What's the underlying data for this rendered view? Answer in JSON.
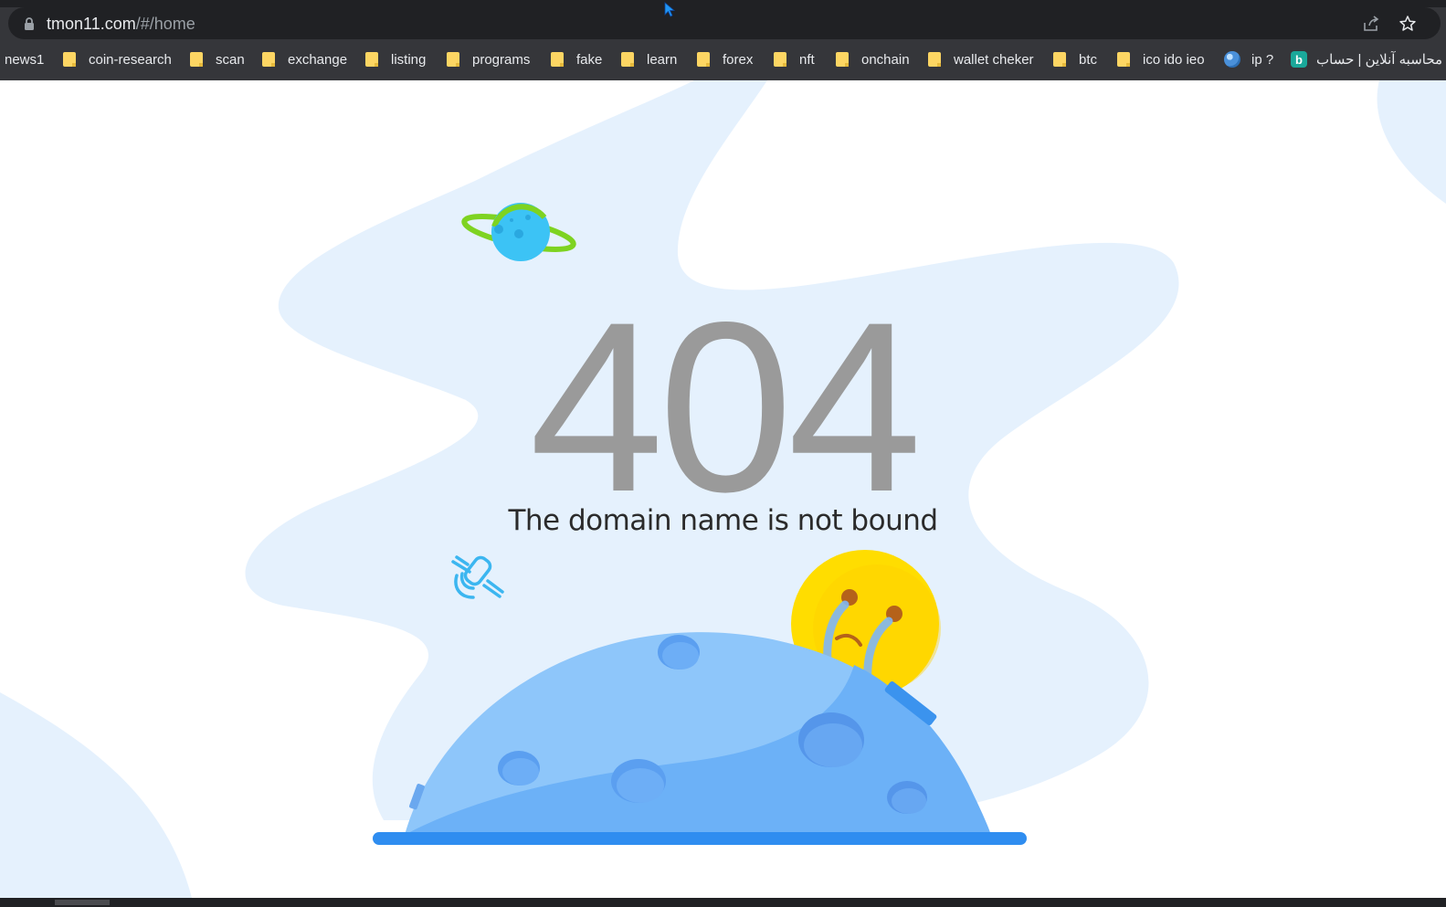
{
  "browser": {
    "url_host": "tmon11.com",
    "url_path": "/#/home",
    "bookmarks": [
      {
        "label": "news1",
        "icon": "none"
      },
      {
        "label": "coin-research",
        "icon": "folder-icon"
      },
      {
        "label": "scan",
        "icon": "folder-icon"
      },
      {
        "label": "exchange",
        "icon": "folder-icon"
      },
      {
        "label": "listing",
        "icon": "folder-icon"
      },
      {
        "label": "programs",
        "icon": "folder-icon"
      },
      {
        "label": "fake",
        "icon": "folder-icon"
      },
      {
        "label": "learn",
        "icon": "folder-icon"
      },
      {
        "label": "forex",
        "icon": "folder-icon"
      },
      {
        "label": "nft",
        "icon": "folder-icon"
      },
      {
        "label": "onchain",
        "icon": "folder-icon"
      },
      {
        "label": "wallet cheker",
        "icon": "folder-icon"
      },
      {
        "label": "btc",
        "icon": "folder-icon"
      },
      {
        "label": "ico ido ieo",
        "icon": "folder-icon"
      },
      {
        "label": "ip ?",
        "icon": "globe-icon"
      },
      {
        "label": "محاسبه آنلاین | حساب",
        "icon": "b-icon",
        "icon_letter": "b"
      }
    ]
  },
  "page": {
    "error_code": "404",
    "message": "The domain name is not bound"
  },
  "colors": {
    "chrome_bg": "#35363a",
    "omnibox_bg": "#202124",
    "blob_bg": "#e5f1fd",
    "planet_blue": "#3cc3f5",
    "planet_ring": "#7ed321",
    "moon_light": "#8ec6fa",
    "moon_dark": "#6cb1f7",
    "ground_line": "#2f8df0",
    "emoji_yellow": "#ffdd00"
  }
}
